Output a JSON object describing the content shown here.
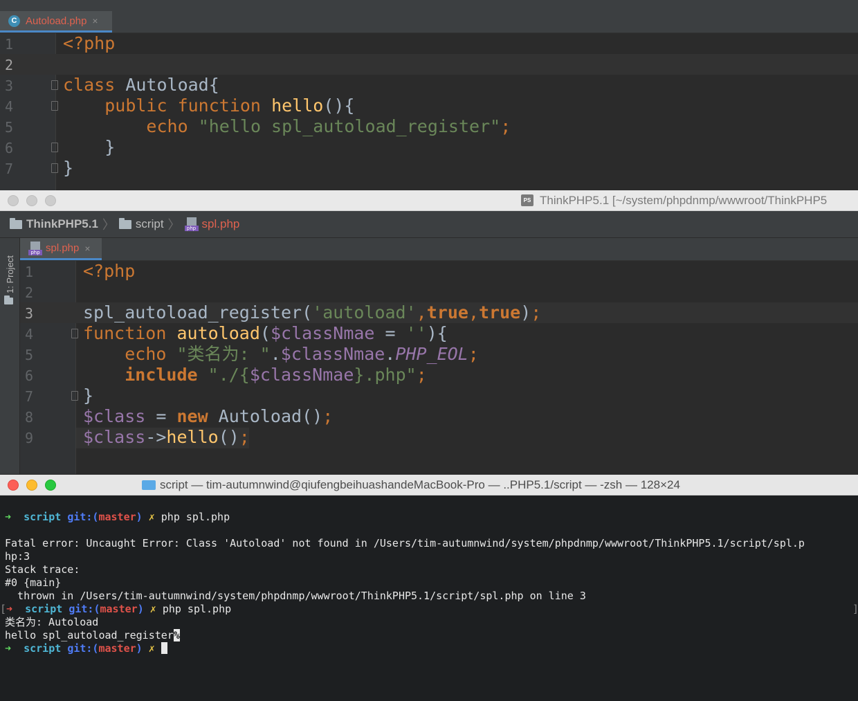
{
  "editor1": {
    "tab_label": "Autoload.php",
    "tab_close": "×",
    "tab_icon_letter": "C",
    "line_numbers": [
      "1",
      "2",
      "3",
      "4",
      "5",
      "6",
      "7"
    ]
  },
  "window2": {
    "title": "ThinkPHP5.1 [~/system/phpdnmp/wwwroot/ThinkPHP5",
    "title_icon": "PS",
    "breadcrumb": {
      "root": "ThinkPHP5.1",
      "folder": "script",
      "file": "spl.php"
    },
    "sidebar_label": "1: Project",
    "tab_label": "spl.php",
    "tab_close": "×",
    "php_icon_label": "php",
    "line_numbers": [
      "1",
      "2",
      "3",
      "4",
      "5",
      "6",
      "7",
      "8",
      "9"
    ]
  },
  "terminal": {
    "title": "script — tim-autumnwind@qiufengbeihuashandeMacBook-Pro — ..PHP5.1/script — -zsh — 128×24",
    "prompt": {
      "arrow": "➜",
      "dir": "script",
      "git": "git:(",
      "branch": "master",
      "git_close": ")",
      "dirty": "✗"
    },
    "cmd1": "php spl.php",
    "error_line1": "Fatal error: Uncaught Error: Class 'Autoload' not found in /Users/tim-autumnwind/system/phpdnmp/wwwroot/ThinkPHP5.1/script/spl.p",
    "error_line2": "hp:3",
    "error_line3": "Stack trace:",
    "error_line4": "#0 {main}",
    "error_line5": "  thrown in /Users/tim-autumnwind/system/phpdnmp/wwwroot/ThinkPHP5.1/script/spl.php on line 3",
    "cmd2": "php spl.php",
    "output1": "类名为: Autoload",
    "output2": "hello spl_autoload_register",
    "output2_end": "%",
    "bracket_left": "[",
    "bracket_right": "]"
  },
  "colors": {
    "editor_bg": "#2b2b2b",
    "keyword": "#cc7832",
    "string": "#6a8759",
    "variable": "#9876aa",
    "function": "#ffc66d",
    "terminal_bg": "#1d1f21"
  }
}
